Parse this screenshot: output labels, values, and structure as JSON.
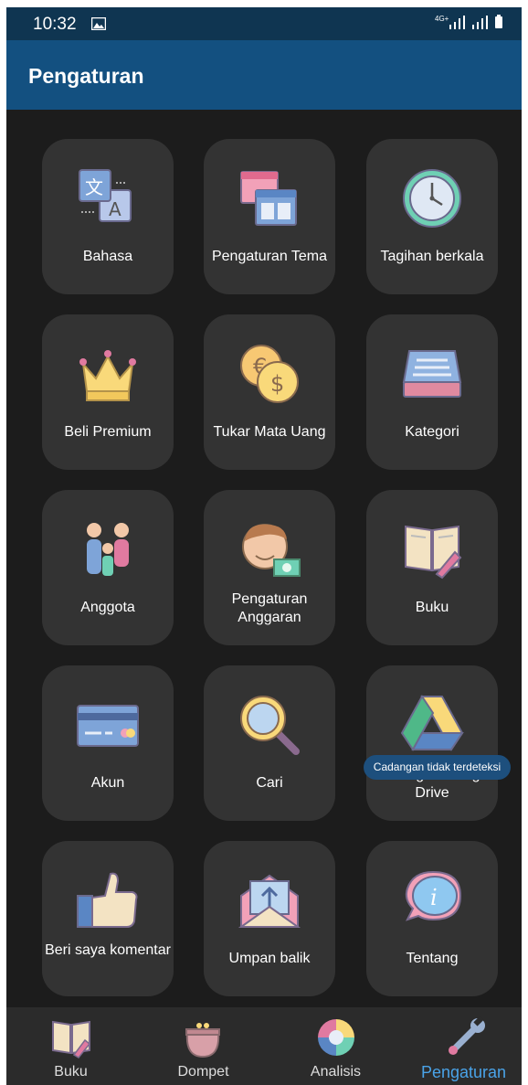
{
  "status_bar": {
    "time": "10:32",
    "network": "4G+",
    "icons": [
      "image-icon",
      "signal-icon",
      "signal-icon",
      "battery-icon"
    ]
  },
  "app_bar": {
    "title": "Pengaturan"
  },
  "tiles": [
    {
      "label": "Bahasa",
      "icon": "translate-icon"
    },
    {
      "label": "Pengaturan Tema",
      "icon": "theme-icon"
    },
    {
      "label": "Tagihan berkala",
      "icon": "clock-icon"
    },
    {
      "label": "Beli Premium",
      "icon": "crown-icon"
    },
    {
      "label": "Tukar Mata Uang",
      "icon": "currency-exchange-icon"
    },
    {
      "label": "Kategori",
      "icon": "tray-icon"
    },
    {
      "label": "Anggota",
      "icon": "family-icon"
    },
    {
      "label": "Pengaturan Anggaran",
      "icon": "budget-icon"
    },
    {
      "label": "Buku",
      "icon": "book-icon"
    },
    {
      "label": "Akun",
      "icon": "credit-card-icon"
    },
    {
      "label": "Cari",
      "icon": "magnifier-icon"
    },
    {
      "label": "Cadangan Google Drive",
      "icon": "google-drive-icon"
    },
    {
      "label": "Beri saya komentar",
      "icon": "thumbs-up-icon"
    },
    {
      "label": "Umpan balik",
      "icon": "feedback-envelope-icon"
    },
    {
      "label": "Tentang",
      "icon": "info-bubble-icon"
    }
  ],
  "backup_badge": "Cadangan tidak terdeteksi",
  "bottom_nav": [
    {
      "label": "Buku",
      "icon": "book-icon",
      "active": false
    },
    {
      "label": "Dompet",
      "icon": "wallet-icon",
      "active": false
    },
    {
      "label": "Analisis",
      "icon": "pie-chart-icon",
      "active": false
    },
    {
      "label": "Pengaturan",
      "icon": "wrench-icon",
      "active": true
    }
  ],
  "colors": {
    "status_bar": "#0f3551",
    "app_bar": "#135080",
    "background": "#1c1c1c",
    "tile": "#333333",
    "nav_bar": "#2b2b2b",
    "active_nav": "#4aa3e8",
    "badge": "#1d4f7d"
  }
}
